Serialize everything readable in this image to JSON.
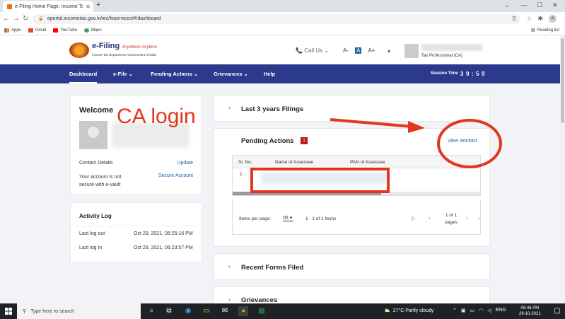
{
  "browser": {
    "tab_title": "e-Filing Home Page, Income Tax",
    "url": "eportal.incometax.gov.in/iec/foservices/#/dashboard",
    "bookmarks": [
      "Apps",
      "Gmail",
      "YouTube",
      "Maps"
    ],
    "reading_list": "Reading list",
    "profile_initial": "e"
  },
  "site": {
    "brand": "e-Filing",
    "tagline": "Anywhere Anytime",
    "subtitle": "Income Tax Department, Government of India",
    "call_us": "Call Us",
    "font_controls": [
      "A-",
      "A",
      "A+"
    ],
    "user_role": "Tax Professional (CA)"
  },
  "nav": {
    "items": [
      "Dashboard",
      "e-File",
      "Pending Actions",
      "Grievances",
      "Help"
    ],
    "session_label": "Session Time",
    "session_value": "39:59"
  },
  "welcome": {
    "greeting": "Welcome",
    "contact": "Contact Details",
    "update": "Update",
    "notice": "Your account is not secure with e-vault",
    "secure": "Secure Account"
  },
  "annotation": {
    "label": "CA login",
    "color": "#e2361e"
  },
  "activity": {
    "title": "Activity Log",
    "rows": [
      {
        "label": "Last log out",
        "value": "Oct 29, 2021, 06:25:16 PM"
      },
      {
        "label": "Last log In",
        "value": "Oct 29, 2021, 06:23:57 PM"
      }
    ]
  },
  "sections": {
    "last3": "Last 3 years Filings",
    "recent": "Recent Forms Filed",
    "grievances": "Grievances"
  },
  "pending": {
    "title": "Pending Actions",
    "count": "1",
    "view_worklist": "View Worklist",
    "columns": [
      "Sl. No.",
      "Name of Assessee",
      "PAN of Assessee"
    ],
    "rows": [
      {
        "sl": "1."
      }
    ],
    "items_per_page_label": "Items per page:",
    "items_per_page": "05",
    "range": "1 - 1 of 1 Items",
    "page": "1 of 1 pages"
  },
  "taskbar": {
    "search_placeholder": "Type here to search",
    "weather": "27°C Partly cloudy",
    "lang": "ENG",
    "time": "06:46 PM",
    "date": "29-10-2021"
  }
}
